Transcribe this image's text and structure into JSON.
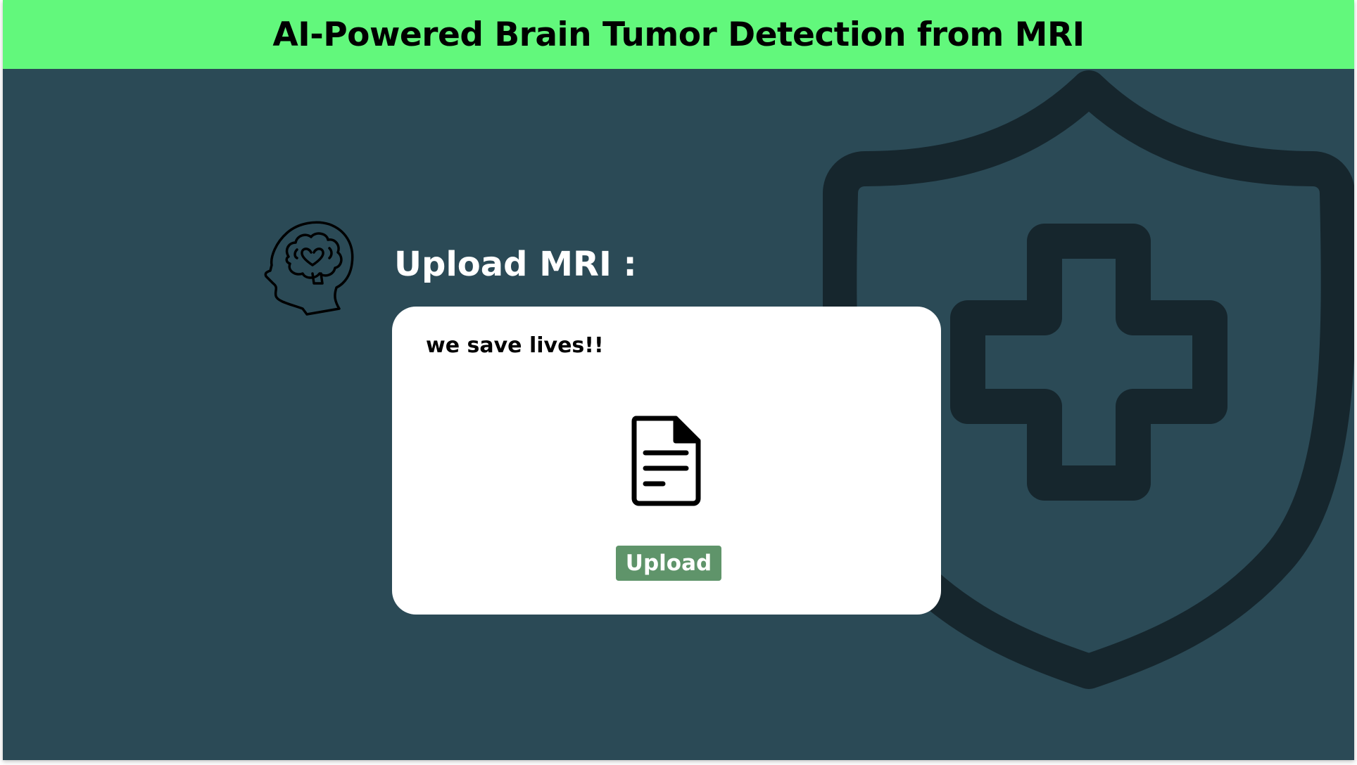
{
  "header": {
    "title": "AI-Powered Brain Tumor Detection from MRI",
    "background_color": "#62f87c"
  },
  "page": {
    "background_color": "#2b4a56",
    "background_icon": "shield-medical-cross-icon"
  },
  "upload_section": {
    "heading": "Upload MRI :",
    "heading_icon": "brain-head-icon",
    "card": {
      "tagline": "we save lives!!",
      "file_icon": "document-icon",
      "button_label": "Upload",
      "button_color": "#5f946a"
    }
  }
}
